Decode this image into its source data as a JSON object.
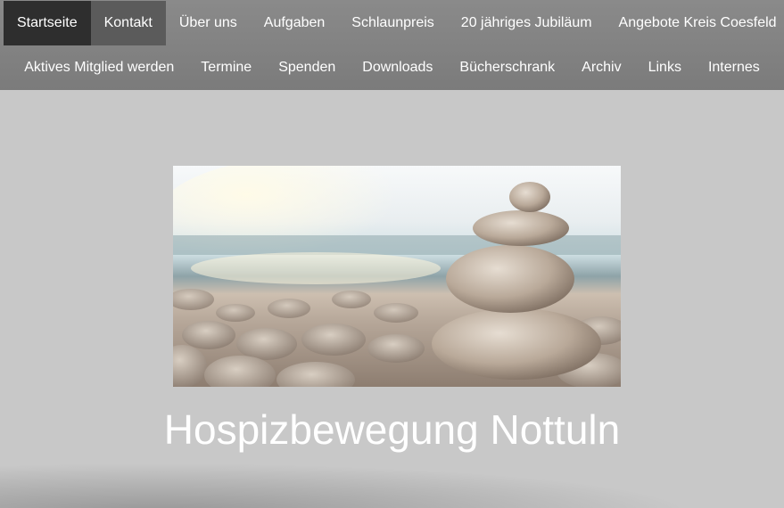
{
  "nav": {
    "row1": [
      {
        "label": "Startseite"
      },
      {
        "label": "Kontakt"
      },
      {
        "label": "Über uns"
      },
      {
        "label": "Aufgaben"
      },
      {
        "label": "Schlaunpreis"
      },
      {
        "label": "20 jähriges Jubiläum"
      },
      {
        "label": "Angebote Kreis Coesfeld"
      }
    ],
    "row2": [
      {
        "label": "Aktives Mitglied werden"
      },
      {
        "label": "Termine"
      },
      {
        "label": "Spenden"
      },
      {
        "label": "Downloads"
      },
      {
        "label": "Bücherschrank"
      },
      {
        "label": "Archiv"
      },
      {
        "label": "Links"
      },
      {
        "label": "Internes"
      }
    ]
  },
  "hero": {
    "image": "stacked-stones-beach-photo"
  },
  "site_title": "Hospizbewegung Nottuln",
  "colors": {
    "nav_bg": "#7f7f7f",
    "nav_active": "#2e2e2e",
    "nav_hover": "#5b5b5b",
    "page_bg": "#c8c8c8",
    "title_text": "#ffffff"
  }
}
